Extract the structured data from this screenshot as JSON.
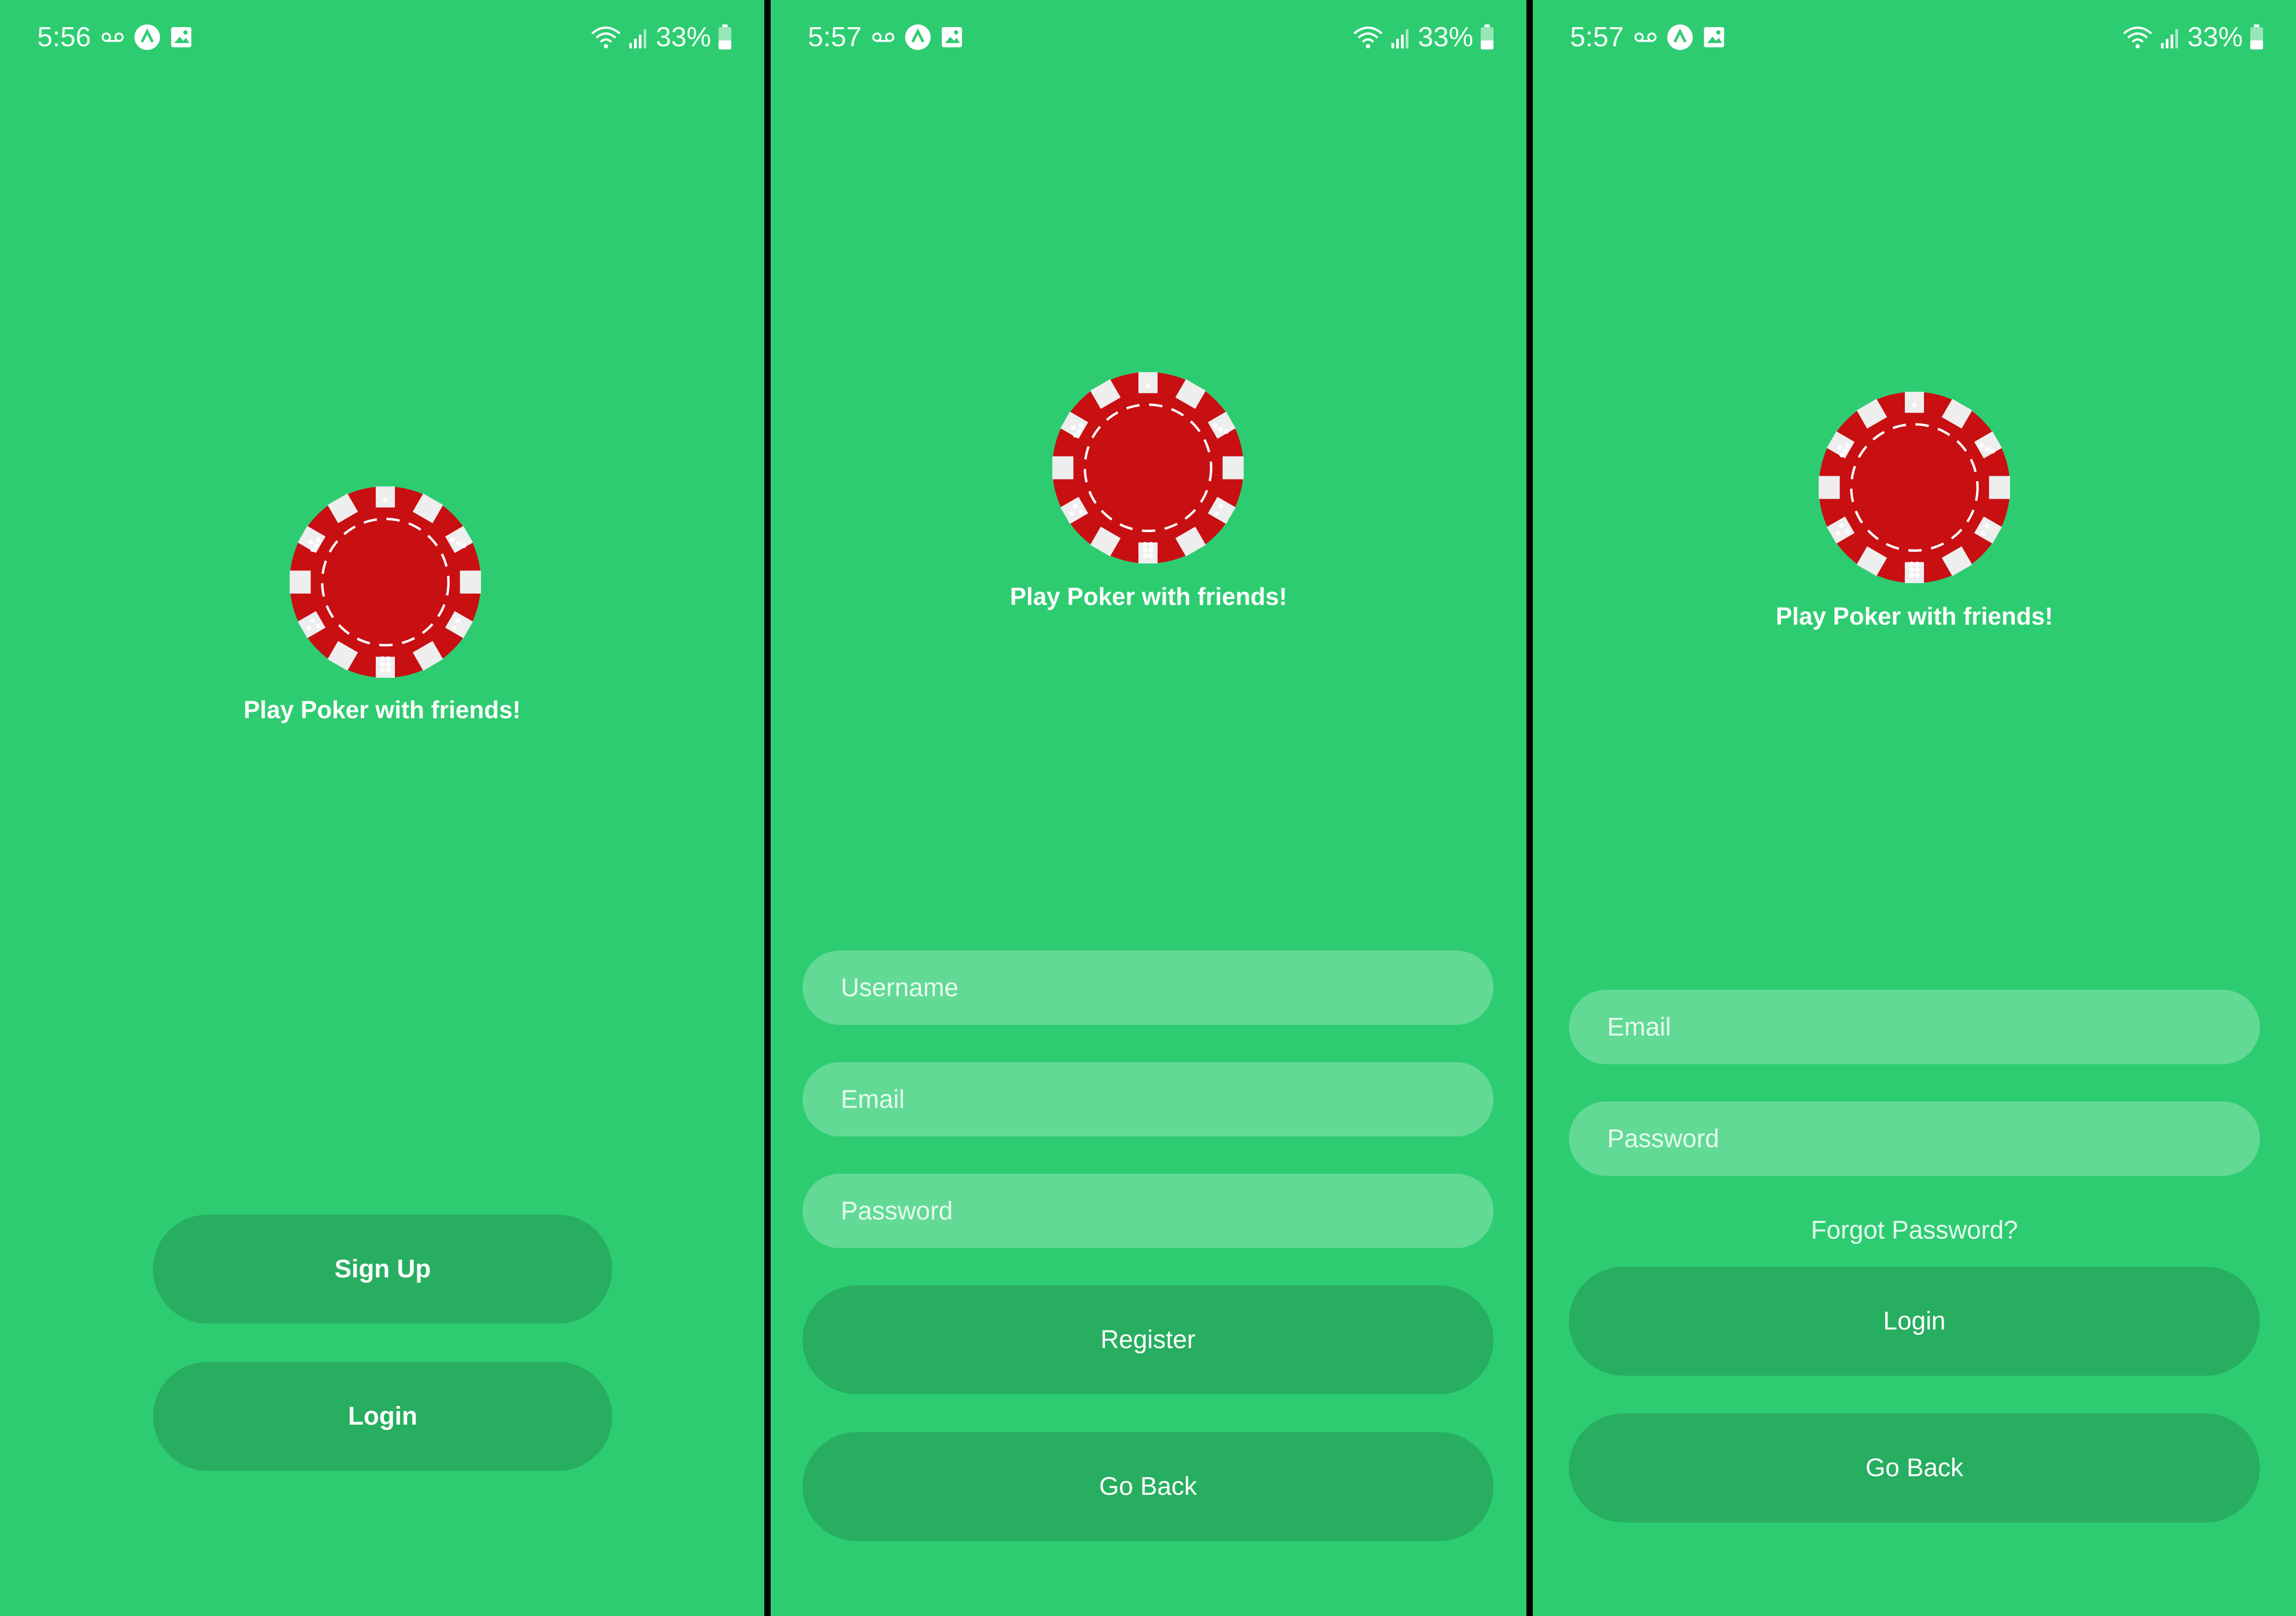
{
  "screens": [
    {
      "status": {
        "time": "5:56",
        "battery": "33%"
      },
      "tagline": "Play Poker with friends!",
      "buttons": {
        "signup": "Sign Up",
        "login": "Login"
      }
    },
    {
      "status": {
        "time": "5:57",
        "battery": "33%"
      },
      "tagline": "Play Poker with friends!",
      "fields": {
        "username_placeholder": "Username",
        "email_placeholder": "Email",
        "password_placeholder": "Password"
      },
      "buttons": {
        "register": "Register",
        "go_back": "Go Back"
      }
    },
    {
      "status": {
        "time": "5:57",
        "battery": "33%"
      },
      "tagline": "Play Poker with friends!",
      "fields": {
        "email_placeholder": "Email",
        "password_placeholder": "Password"
      },
      "forgot_password": "Forgot Password?",
      "buttons": {
        "login": "Login",
        "go_back": "Go Back"
      }
    }
  ],
  "colors": {
    "background": "#2ecc71",
    "button": "#27ae60",
    "input": "#62da95",
    "chip_red": "#c80f12",
    "chip_white": "#eeeeee",
    "divider": "#000000"
  },
  "icons": [
    "voicemail-icon",
    "app-badge-icon",
    "gallery-icon",
    "wifi-icon",
    "signal-icon",
    "battery-icon",
    "poker-chip-logo"
  ]
}
